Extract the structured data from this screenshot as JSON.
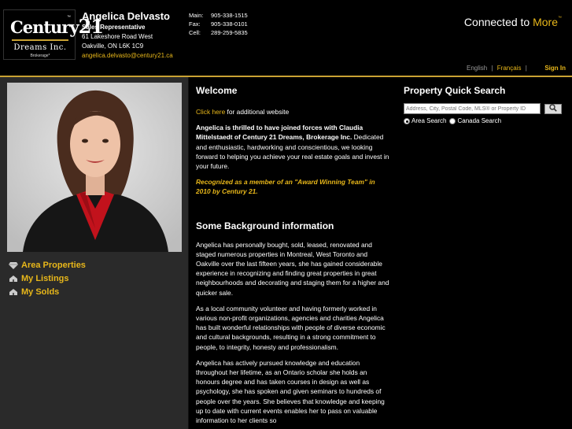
{
  "brand": {
    "logo_word": "Century",
    "logo_num": "21",
    "logo_office": "Dreams Inc.",
    "logo_sub": "Brokerage*",
    "tagline_main": "Connected to ",
    "tagline_more": "More",
    "tagline_tm": "™",
    "accent": "#e8b71a"
  },
  "agent": {
    "name": "Angelica Delvasto",
    "title": "Sales Representative",
    "address1": "61 Lakeshore Road West",
    "address2": "Oakville, ON  L6K 1C9",
    "email": "angelica.delvasto@century21.ca"
  },
  "phones": [
    {
      "label": "Main:",
      "value": "905-338-1515"
    },
    {
      "label": "Fax:",
      "value": "905-338-0101"
    },
    {
      "label": "Cell:",
      "value": "289-259-5835"
    }
  ],
  "lang": {
    "english": "English",
    "sep1": "|",
    "french": "Français",
    "sep2": "|",
    "signin": "Sign In"
  },
  "nav": [
    {
      "label": "Area Properties",
      "icon": "diamond-icon"
    },
    {
      "label": "My Listings",
      "icon": "house-icon"
    },
    {
      "label": "My Solds",
      "icon": "house-icon"
    }
  ],
  "welcome": {
    "heading": "Welcome",
    "link": "Click here",
    "link_rest": " for additional website",
    "intro_bold": "Angelica is thrilled to have joined forces with Claudia Mittelstaedt of Century 21 Dreams, Brokerage Inc.",
    "intro_rest": " Dedicated and enthusiastic, hardworking and conscientious, we looking forward to helping you achieve your real estate goals and invest in your future.",
    "award": " Recognized as a member of an \"Award Winning Team\" in 2010 by Century 21."
  },
  "background": {
    "heading": "Some Background information",
    "p1": "Angelica has personally bought, sold, leased, renovated and staged numerous properties in Montreal, West Toronto and Oakville over the last fifteen years, she has gained considerable experience in recognizing and finding great properties in great neighbourhoods and decorating and staging them for a higher and quicker sale.",
    "p2": "As a local community volunteer and having formerly worked in various non-profit organizations, agencies and charities Angelica has built wonderful relationships with people of diverse economic and cultural backgrounds, resulting in a strong commitment to people, to integrity, honesty and professionalism.",
    "p3": "Angelica has actively pursued knowledge and education throughout her lifetime, as an Ontario scholar she holds an honours degree and has taken courses in design as well as psychology, she has spoken and given seminars to hundreds of people over the years. She believes that knowledge and keeping up to date with current events enables her to pass on valuable information to her clients so"
  },
  "search": {
    "heading": "Property Quick Search",
    "placeholder": "Address, City, Postal Code, MLS® or Property ID",
    "option_area": "Area Search",
    "option_canada": "Canada Search",
    "selected": "Area Search"
  }
}
